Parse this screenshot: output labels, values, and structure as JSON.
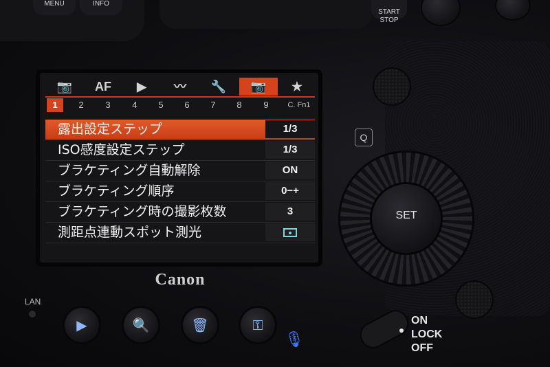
{
  "top_buttons": {
    "menu_label": "MENU",
    "info_label": "INFO",
    "start_stop_label": "START\nSTOP"
  },
  "tabs": [
    {
      "label": "📷",
      "icon": "camera-icon"
    },
    {
      "label": "AF",
      "icon": "af-icon"
    },
    {
      "label": "▶",
      "icon": "playback-icon"
    },
    {
      "label": "〰",
      "icon": "network-icon"
    },
    {
      "label": "🔧",
      "icon": "wrench-icon"
    },
    {
      "label": "📷",
      "icon": "custom-function-icon",
      "active": true
    },
    {
      "label": "★",
      "icon": "star-icon"
    }
  ],
  "pages": [
    "1",
    "2",
    "3",
    "4",
    "5",
    "6",
    "7",
    "8",
    "9",
    "C. Fn1"
  ],
  "active_page": "1",
  "menu_items": [
    {
      "label": "露出設定ステップ",
      "value": "1/3",
      "selected": true
    },
    {
      "label": "ISO感度設定ステップ",
      "value": "1/3"
    },
    {
      "label": "ブラケティング自動解除",
      "value": "ON"
    },
    {
      "label": "ブラケティング順序",
      "value": "0−+"
    },
    {
      "label": "ブラケティング時の撮影枚数",
      "value": "3"
    },
    {
      "label": "測距点連動スポット測光",
      "value": "",
      "value_icon": "spot-metering-icon"
    }
  ],
  "brand": "Canon",
  "lan_label": "LAN",
  "q_label": "Q",
  "set_label": "SET",
  "power_switch": {
    "on": "ON",
    "lock": "LOCK",
    "off": "OFF"
  },
  "bottom_buttons": [
    {
      "icon": "playback-button-icon",
      "glyph": "▶"
    },
    {
      "icon": "zoom-icon",
      "glyph": "🔍"
    },
    {
      "icon": "trash-icon",
      "glyph": "🗑"
    },
    {
      "icon": "protect-key-icon",
      "glyph": "⚿"
    }
  ],
  "colors": {
    "accent": "#d4421e",
    "spot_icon": "#7fd6e0",
    "mic_icon": "#3a7cff"
  }
}
